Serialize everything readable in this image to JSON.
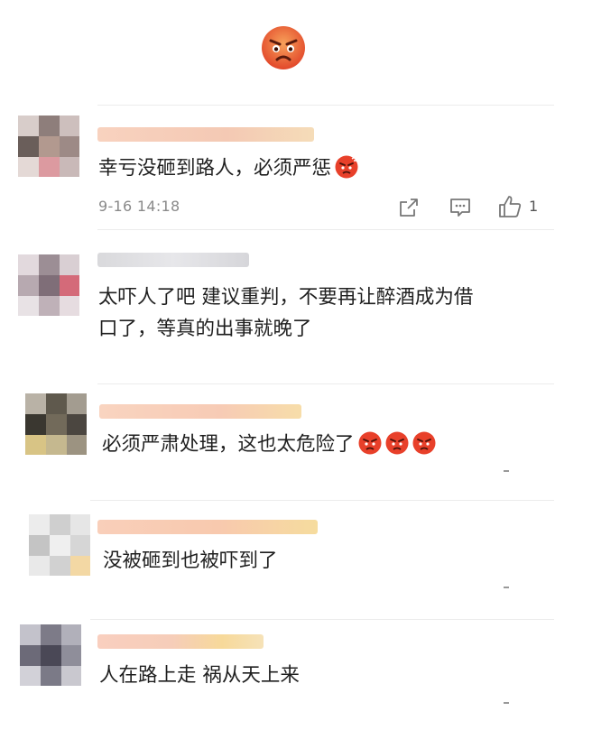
{
  "comments": [
    {
      "text": "幸亏没砸到路人，必须严惩",
      "emojis": [
        "angry-face"
      ],
      "time": "9-16 14:18",
      "likes": "1",
      "actions": [
        "share-icon",
        "comment-icon",
        "like-icon"
      ]
    },
    {
      "line1": "太吓人了吧 建议重判，不要再让醉酒成为借",
      "line2": "口了，等真的出事就晚了"
    },
    {
      "text": "必须严肃处理，这也太危险了",
      "emojis": [
        "angry-face",
        "angry-face",
        "angry-face"
      ]
    },
    {
      "text": "没被砸到也被吓到了"
    },
    {
      "text": "人在路上走 祸从天上来"
    }
  ],
  "colors": {
    "emoji_red": "#e8402a",
    "emoji_orange": "#f5a24a",
    "name_blur": "#f6c6a8",
    "icon_gray": "#777777"
  }
}
